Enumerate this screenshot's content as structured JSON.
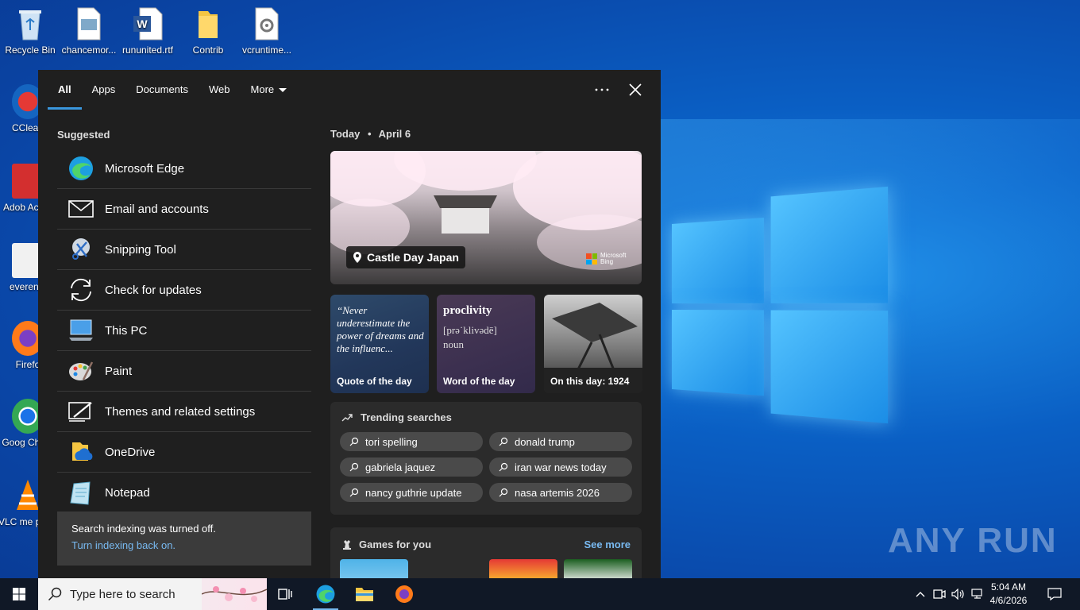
{
  "desktop": {
    "icons": [
      {
        "label": "Recycle Bin"
      },
      {
        "label": "chancemor..."
      },
      {
        "label": "rununited.rtf"
      },
      {
        "label": "Contrib"
      },
      {
        "label": "vcruntime..."
      },
      {
        "label": "CClean"
      },
      {
        "label": "Adob Acrob"
      },
      {
        "label": "everendi"
      },
      {
        "label": "Firefo"
      },
      {
        "label": "Goog Chron"
      },
      {
        "label": "VLC me playe"
      }
    ],
    "watermark": "ANY RUN"
  },
  "search_panel": {
    "tabs": [
      {
        "label": "All",
        "active": true
      },
      {
        "label": "Apps"
      },
      {
        "label": "Documents"
      },
      {
        "label": "Web"
      },
      {
        "label": "More"
      }
    ],
    "suggested_heading": "Suggested",
    "suggested": [
      {
        "label": "Microsoft Edge",
        "icon": "edge-icon"
      },
      {
        "label": "Email and accounts",
        "icon": "mail-icon"
      },
      {
        "label": "Snipping Tool",
        "icon": "snipping-tool-icon"
      },
      {
        "label": "Check for updates",
        "icon": "refresh-icon"
      },
      {
        "label": "This PC",
        "icon": "computer-icon"
      },
      {
        "label": "Paint",
        "icon": "paint-palette-icon"
      },
      {
        "label": "Themes and related settings",
        "icon": "themes-icon"
      },
      {
        "label": "OneDrive",
        "icon": "onedrive-icon"
      },
      {
        "label": "Notepad",
        "icon": "notepad-icon"
      }
    ],
    "notice": {
      "text": "Search indexing was turned off.",
      "link": "Turn indexing back on."
    },
    "today": {
      "label": "Today",
      "separator": "•",
      "date": "April 6"
    },
    "hero": {
      "caption": "Castle Day Japan",
      "brand_line1": "Microsoft",
      "brand_line2": "Bing"
    },
    "cards": {
      "quote_text": "“Never underestimate the power of dreams and the influenc...",
      "quote_caption": "Quote of the day",
      "word": "proclivity",
      "word_pron": "[prə˙klivədē]",
      "word_type": "noun",
      "word_caption": "Word of the day",
      "history_caption": "On this day: 1924"
    },
    "trending": {
      "heading": "Trending searches",
      "items": [
        "tori spelling",
        "donald trump",
        "gabriela jaquez",
        "iran war news today",
        "nancy guthrie update",
        "nasa artemis 2026"
      ]
    },
    "games": {
      "heading": "Games for you",
      "see_more": "See more"
    }
  },
  "taskbar": {
    "search_placeholder": "Type here to search",
    "clock_time": "5:04 AM",
    "clock_date": "4/6/2026"
  },
  "colors": {
    "accent": "#3a96dd",
    "link": "#78b9f0",
    "panel_bg": "#1f1f1f"
  }
}
